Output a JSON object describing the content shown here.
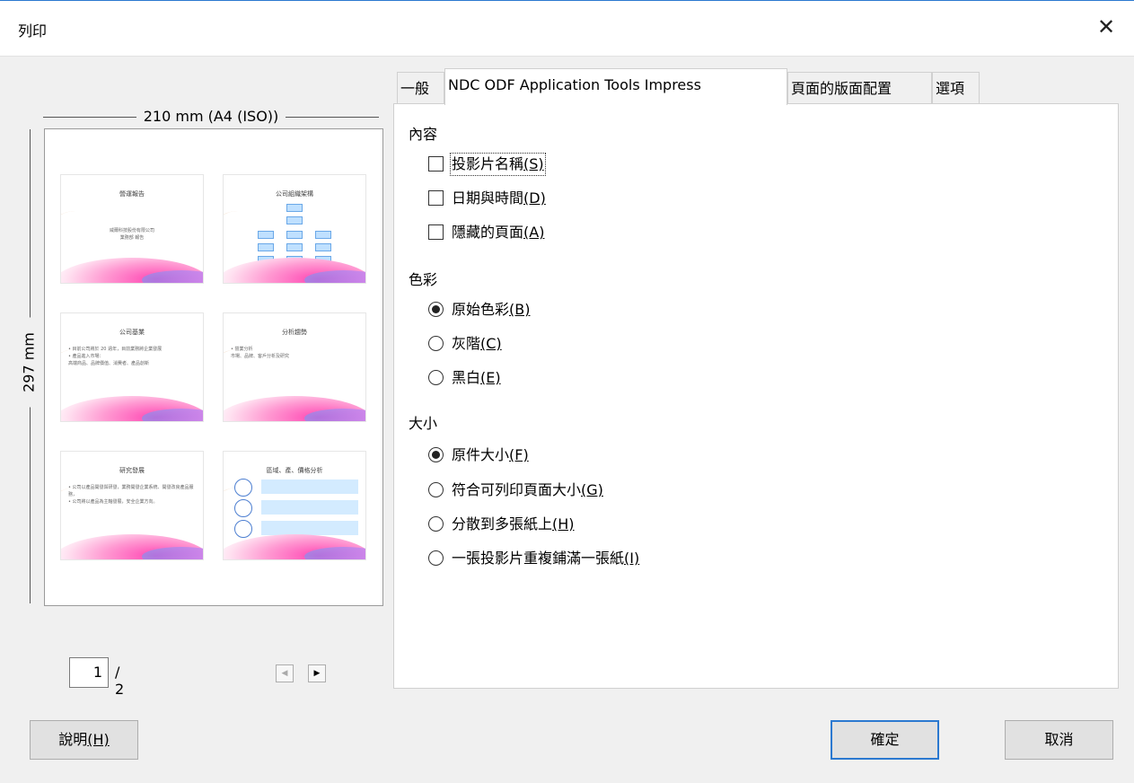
{
  "window": {
    "title": "列印",
    "close_glyph": "✕"
  },
  "preview": {
    "width_label": "210 mm (A4 (ISO))",
    "height_label": "297 mm",
    "current_page": "1",
    "total_pages": "/ 2",
    "slides": [
      {
        "title": "營運報告",
        "lines": [
          "威爾科技股份有限公司",
          "業務部 報告"
        ]
      },
      {
        "title": "公司組織架構",
        "lines": []
      },
      {
        "title": "公司基業",
        "lines": [
          "• 目前公司將於 20 週年，目前業務將企業發展",
          "• 產品進入市場：",
          "  高端商品、品牌價值、消費者、產品創新"
        ]
      },
      {
        "title": "分析趨勢",
        "lines": [
          "• 營業分析",
          "  市場、品牌、客戶分析及研究"
        ]
      },
      {
        "title": "研究發展",
        "lines": [
          "• 公司以產品開發與研發，業務開發企業系統、開發改良產品服務，",
          "• 公司將以產品為主軸發展，安全企業方向。"
        ]
      },
      {
        "title": "區域、產、價格分析",
        "lines": []
      }
    ]
  },
  "tabs": [
    {
      "label": "一般"
    },
    {
      "label": "NDC ODF Application Tools Impress"
    },
    {
      "label": "頁面的版面配置"
    },
    {
      "label": "選項"
    }
  ],
  "content_section": {
    "title": "內容",
    "options": [
      {
        "label": "投影片名稱",
        "mnemonic": "(S)",
        "checked": false
      },
      {
        "label": "日期與時間",
        "mnemonic": "(D)",
        "checked": false
      },
      {
        "label": "隱藏的頁面",
        "mnemonic": "(A)",
        "checked": false
      }
    ]
  },
  "color_section": {
    "title": "色彩",
    "options": [
      {
        "label": "原始色彩",
        "mnemonic": "(B)",
        "selected": true
      },
      {
        "label": "灰階",
        "mnemonic": "(C)",
        "selected": false
      },
      {
        "label": "黑白",
        "mnemonic": "(E)",
        "selected": false
      }
    ]
  },
  "size_section": {
    "title": "大小",
    "options": [
      {
        "label": "原件大小",
        "mnemonic": "(F)",
        "selected": true
      },
      {
        "label": "符合可列印頁面大小",
        "mnemonic": "(G)",
        "selected": false
      },
      {
        "label": "分散到多張紙上",
        "mnemonic": "(H)",
        "selected": false
      },
      {
        "label": "一張投影片重複鋪滿一張紙",
        "mnemonic": "(I)",
        "selected": false
      }
    ]
  },
  "buttons": {
    "help": {
      "label": "說明",
      "mnemonic": "(H)"
    },
    "ok": "確定",
    "cancel": "取消"
  },
  "colors": {
    "accent": "#2b79d0",
    "background": "#f0f0f0",
    "panel": "#ffffff"
  }
}
